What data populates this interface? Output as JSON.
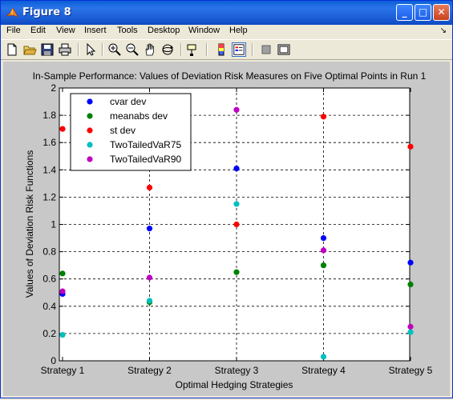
{
  "window": {
    "title": "Figure 8",
    "minimize_label": "_",
    "maximize_label": "□",
    "close_label": "✕"
  },
  "menu": {
    "items": [
      "File",
      "Edit",
      "View",
      "Insert",
      "Tools",
      "Desktop",
      "Window",
      "Help"
    ],
    "dock_arrow": "↘"
  },
  "toolbar": {
    "icons": [
      "new-figure-icon",
      "open-file-icon",
      "save-icon",
      "print-icon",
      "edit-plot-icon",
      "zoom-in-icon",
      "zoom-out-icon",
      "pan-icon",
      "rotate-3d-icon",
      "data-cursor-icon",
      "insert-colorbar-icon",
      "insert-legend-icon",
      "hide-plot-tools-icon",
      "show-plot-tools-icon"
    ]
  },
  "colors": {
    "blue": "#0000ff",
    "green": "#008000",
    "red": "#ff0000",
    "cyan": "#00bfbf",
    "magenta": "#bf00bf"
  },
  "chart_data": {
    "type": "scatter",
    "title": "In-Sample Performance: Values of Deviation Risk Measures on Five Optimal Points in Run 1",
    "xlabel": "Optimal Hedging Strategies",
    "ylabel": "Values of Deviation Risk Functions",
    "categories": [
      "Strategy 1",
      "Strategy 2",
      "Strategy 3",
      "Strategy 4",
      "Strategy 5"
    ],
    "ylim": [
      0,
      2
    ],
    "yticks": [
      0,
      0.2,
      0.4,
      0.6,
      0.8,
      1,
      1.2,
      1.4,
      1.6,
      1.8,
      2
    ],
    "ytick_labels": [
      "0",
      "0.2",
      "0.4",
      "0.6",
      "0.8",
      "1",
      "1.2",
      "1.4",
      "1.6",
      "1.8",
      "2"
    ],
    "grid": true,
    "legend_position": "top-left",
    "series": [
      {
        "name": "cvar dev",
        "color": "#0000ff",
        "values": [
          0.49,
          0.97,
          1.41,
          0.9,
          0.72
        ]
      },
      {
        "name": "meanabs dev",
        "color": "#008000",
        "values": [
          0.64,
          0.43,
          0.65,
          0.7,
          0.56
        ]
      },
      {
        "name": "st dev",
        "color": "#ff0000",
        "values": [
          1.7,
          1.27,
          1.0,
          1.79,
          1.57
        ]
      },
      {
        "name": "TwoTailedVaR75",
        "color": "#00bfbf",
        "values": [
          0.19,
          0.44,
          1.15,
          0.03,
          0.21
        ]
      },
      {
        "name": "TwoTailedVaR90",
        "color": "#bf00bf",
        "values": [
          0.51,
          0.61,
          1.84,
          0.81,
          0.25
        ]
      }
    ]
  }
}
